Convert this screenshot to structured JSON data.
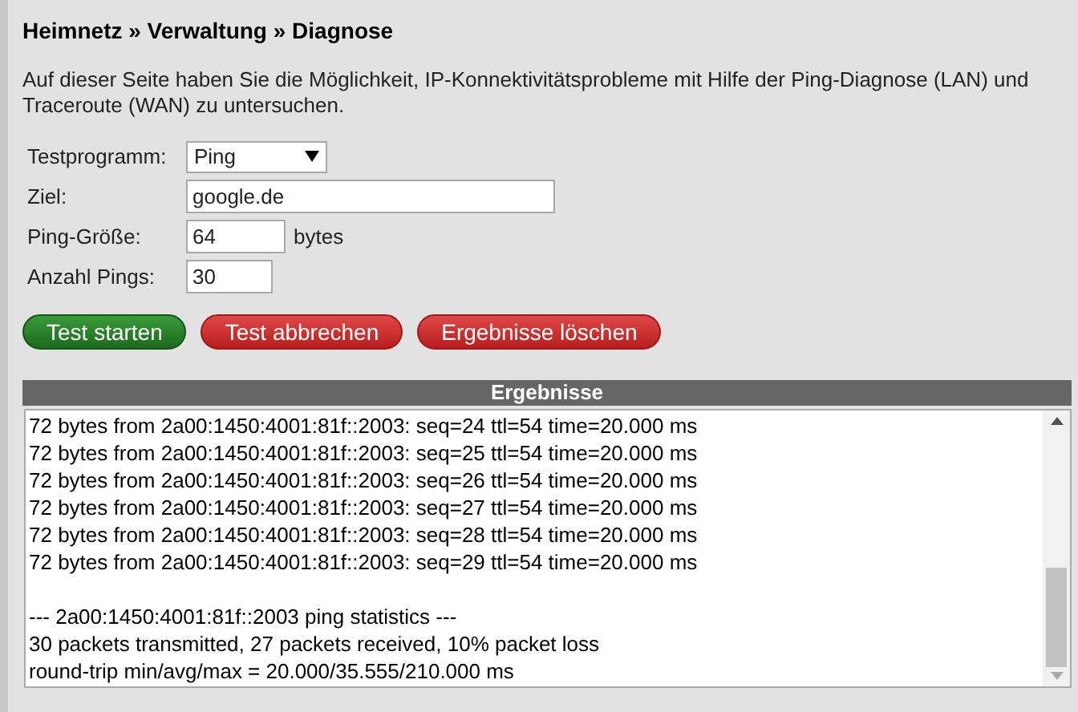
{
  "breadcrumb": "Heimnetz » Verwaltung » Diagnose",
  "description": "Auf dieser Seite haben Sie die Möglichkeit, IP-Konnektivitätsprobleme mit Hilfe der Ping-Diagnose (LAN) und Traceroute (WAN) zu untersuchen.",
  "form": [
    {
      "kind": "select",
      "label": "Testprogramm:",
      "value": "Ping"
    },
    {
      "kind": "text",
      "label": "Ziel:",
      "value": "google.de"
    },
    {
      "kind": "number",
      "label": "Ping-Größe:",
      "value": "64",
      "unit": "bytes"
    },
    {
      "kind": "count",
      "label": "Anzahl Pings:",
      "value": "30"
    }
  ],
  "buttons": [
    {
      "label": "Test starten",
      "kind": "primary"
    },
    {
      "label": "Test abbrechen",
      "kind": "danger"
    },
    {
      "label": "Ergebnisse löschen",
      "kind": "danger"
    }
  ],
  "results": {
    "title": "Ergebnisse",
    "lines": [
      "72 bytes from 2a00:1450:4001:81f::2003: seq=24 ttl=54 time=20.000 ms",
      "72 bytes from 2a00:1450:4001:81f::2003: seq=25 ttl=54 time=20.000 ms",
      "72 bytes from 2a00:1450:4001:81f::2003: seq=26 ttl=54 time=20.000 ms",
      "72 bytes from 2a00:1450:4001:81f::2003: seq=27 ttl=54 time=20.000 ms",
      "72 bytes from 2a00:1450:4001:81f::2003: seq=28 ttl=54 time=20.000 ms",
      "72 bytes from 2a00:1450:4001:81f::2003: seq=29 ttl=54 time=20.000 ms"
    ],
    "statistics": [
      "--- 2a00:1450:4001:81f::2003 ping statistics ---",
      "30 packets transmitted, 27 packets received, 10% packet loss",
      "round-trip min/avg/max = 20.000/35.555/210.000 ms"
    ]
  }
}
